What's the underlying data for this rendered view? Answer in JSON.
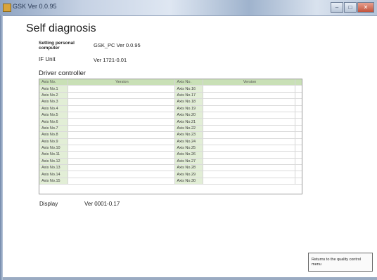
{
  "window": {
    "title": "GSK Ver 0.0.95",
    "minimize": "–",
    "maximize": "□",
    "close": "✕"
  },
  "page": {
    "title": "Self diagnosis"
  },
  "info": [
    {
      "label": "Setting personal computer",
      "value": "GSK_PC Ver 0.0.95"
    },
    {
      "label": "IF Unit",
      "value": "Ver 1721-0.01"
    }
  ],
  "driver_controller": {
    "title": "Driver controller",
    "headers": {
      "axis": "Axis No.",
      "version": "Version"
    },
    "left_axes": [
      "Axis No.1",
      "Axis No.2",
      "Axis No.3",
      "Axis No.4",
      "Axis No.5",
      "Axis No.6",
      "Axis No.7",
      "Axis No.8",
      "Axis No.9",
      "Axis No.10",
      "Axis No.11",
      "Axis No.12",
      "Axis No.13",
      "Axis No.14",
      "Axis No.15"
    ],
    "right_axes": [
      "Axis No.16",
      "Axis No.17",
      "Axis No.18",
      "Axis No.19",
      "Axis No.20",
      "Axis No.21",
      "Axis No.22",
      "Axis No.23",
      "Axis No.24",
      "Axis No.25",
      "Axis No.26",
      "Axis No.27",
      "Axis No.28",
      "Axis No.29",
      "Axis No.30"
    ]
  },
  "display": {
    "label": "Display",
    "value": "Ver 0001-0.17"
  },
  "buttons": {
    "return": "Returns to the quality control menu"
  },
  "colors": {
    "table_header": "#c9e0b6",
    "axis_cell": "#e2eed6",
    "titlebar": "#c6d2e4"
  }
}
